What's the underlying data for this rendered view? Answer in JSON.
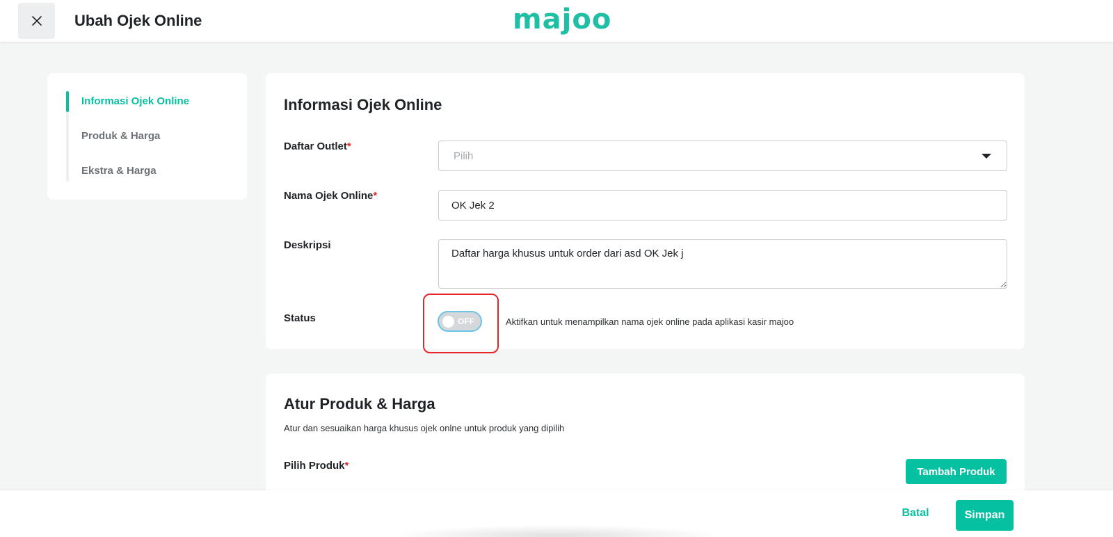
{
  "header": {
    "title": "Ubah Ojek Online",
    "close_icon": "close-icon",
    "logo_text": "majoo"
  },
  "sidebar": {
    "items": [
      {
        "label": "Informasi Ojek Online",
        "active": true
      },
      {
        "label": "Produk & Harga",
        "active": false
      },
      {
        "label": "Ekstra & Harga",
        "active": false
      }
    ]
  },
  "info_section": {
    "title": "Informasi Ojek Online",
    "outlet": {
      "label": "Daftar Outlet",
      "required_mark": "*",
      "placeholder": "Pilih"
    },
    "name": {
      "label": "Nama Ojek Online",
      "required_mark": "*",
      "value": "OK Jek 2"
    },
    "description": {
      "label": "Deskripsi",
      "value": "Daftar harga khusus untuk order dari asd OK Jek j"
    },
    "status": {
      "label": "Status",
      "toggle_text": "OFF",
      "enabled": false,
      "help": "Aktifkan untuk menampilkan nama ojek online pada aplikasi kasir majoo"
    }
  },
  "product_section": {
    "title": "Atur Produk & Harga",
    "subtitle": "Atur dan sesuaikan harga khusus ojek onlne untuk produk yang dipilih",
    "select_label": "Pilih Produk",
    "required_mark": "*",
    "add_button": "Tambah Produk"
  },
  "footer": {
    "cancel_label": "Batal",
    "save_label": "Simpan"
  },
  "colors": {
    "accent": "#05c0a1",
    "required": "#e5252a",
    "highlight": "#e5252a"
  }
}
